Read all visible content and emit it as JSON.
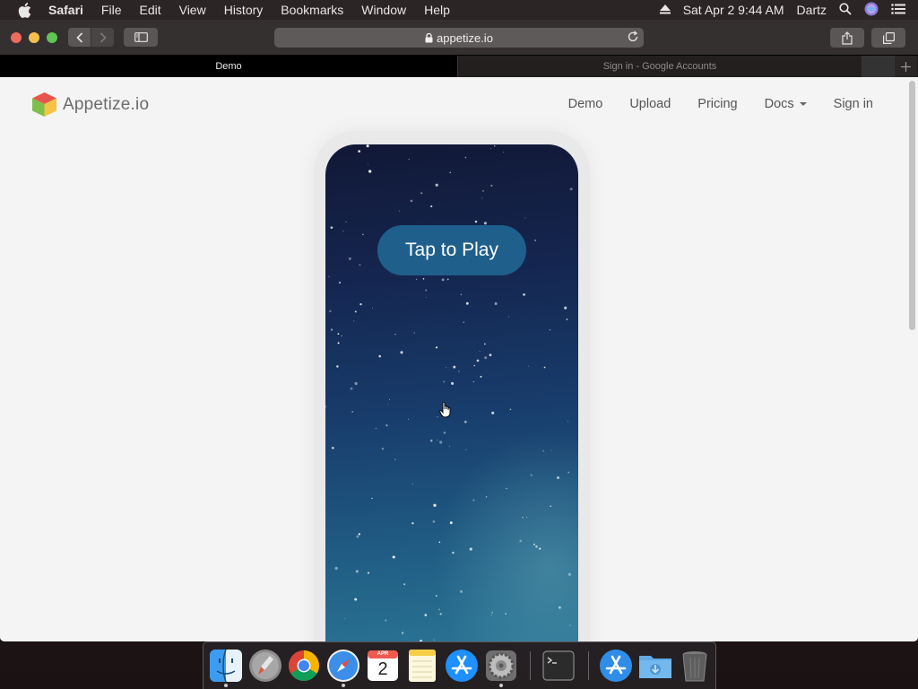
{
  "menubar": {
    "items": [
      "Safari",
      "File",
      "Edit",
      "View",
      "History",
      "Bookmarks",
      "Window",
      "Help"
    ],
    "status": {
      "datetime": "Sat Apr 2  9:44 AM",
      "user": "Dartz"
    }
  },
  "browser": {
    "address": "appetize.io",
    "tabs": [
      {
        "label": "Demo",
        "active": true
      },
      {
        "label": "Sign in - Google Accounts",
        "active": false
      }
    ]
  },
  "page": {
    "logo_text": "Appetize.io",
    "nav": {
      "demo": "Demo",
      "upload": "Upload",
      "pricing": "Pricing",
      "docs": "Docs",
      "signin": "Sign in"
    },
    "device": {
      "tap_to_play": "Tap to Play"
    }
  },
  "dock": {
    "apps": [
      "Finder",
      "Launchpad",
      "Google Chrome",
      "Safari",
      "Calendar",
      "Notes",
      "App Store",
      "System Preferences",
      "Terminal",
      "Applications",
      "Downloads",
      "Trash"
    ],
    "calendar_month": "APR",
    "calendar_day": "2"
  },
  "colors": {
    "accent_button": "#1f5f8c",
    "menubar_bg": "#2b2526",
    "page_bg": "#f4f4f4"
  }
}
